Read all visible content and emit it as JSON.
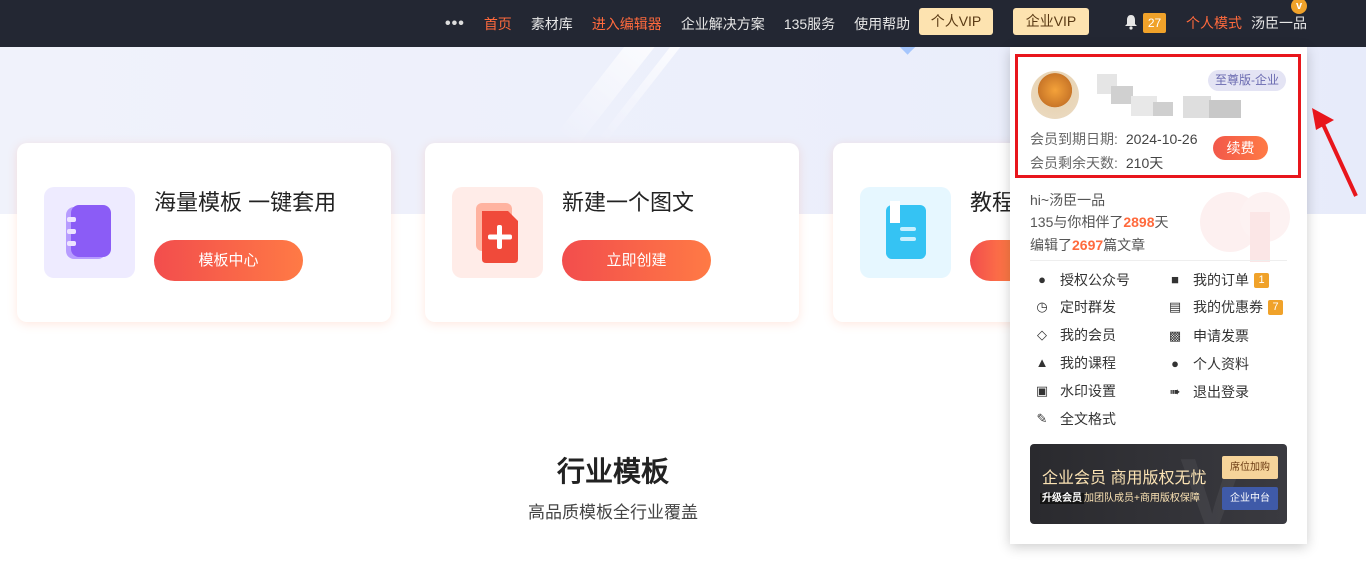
{
  "nav": {
    "more": "•••",
    "items": [
      "首页",
      "素材库",
      "进入编辑器",
      "企业解决方案",
      "135服务",
      "使用帮助"
    ],
    "vip_personal": "个人VIP",
    "vip_enterprise": "企业VIP",
    "notify_count": "27",
    "mode": "个人模式",
    "username": "汤臣一品",
    "v_badge": "v"
  },
  "cards": [
    {
      "title": "海量模板 一键套用",
      "button": "模板中心",
      "icon": "template-book-icon"
    },
    {
      "title": "新建一个图文",
      "button": "立即创建",
      "icon": "add-document-icon"
    },
    {
      "title": "教程",
      "button": "",
      "icon": "tutorial-doc-icon"
    }
  ],
  "section": {
    "title": "行业模板",
    "subtitle": "高品质模板全行业覆盖"
  },
  "panel": {
    "tier": "至尊版-企业",
    "expiry_label": "会员到期日期:",
    "expiry_value": "2024-10-26",
    "remain_label": "会员剩余天数:",
    "remain_value": "210天",
    "renew": "续费",
    "greeting": "hi~汤臣一品",
    "companion_pre": "135与你相伴了",
    "companion_days": "2898",
    "companion_post": "天",
    "edited_pre": "编辑了",
    "edited_count": "2697",
    "edited_post": "篇文章",
    "menu_left": [
      {
        "label": "授权公众号",
        "icon": "wechat-icon"
      },
      {
        "label": "定时群发",
        "icon": "clock-icon"
      },
      {
        "label": "我的会员",
        "icon": "diamond-icon"
      },
      {
        "label": "我的课程",
        "icon": "graduation-cap-icon"
      },
      {
        "label": "水印设置",
        "icon": "image-icon"
      },
      {
        "label": "全文格式",
        "icon": "brush-icon"
      }
    ],
    "menu_right": [
      {
        "label": "我的订单",
        "icon": "cart-icon",
        "count": "1"
      },
      {
        "label": "我的优惠券",
        "icon": "coupon-icon",
        "count": "7"
      },
      {
        "label": "申请发票",
        "icon": "lock-icon"
      },
      {
        "label": "个人资料",
        "icon": "user-icon"
      },
      {
        "label": "退出登录",
        "icon": "logout-icon"
      }
    ],
    "banner": {
      "title": "企业会员 商用版权无忧",
      "sub_bold": "升级会员",
      "sub_rest": "加团队成员+商用版权保障",
      "btn1": "席位加购",
      "btn2": "企业中台"
    }
  },
  "colors": {
    "accent": "#ff6a3d",
    "highlight": "#e8161c",
    "nav_bg": "#232733",
    "badge": "#f0a22a"
  }
}
